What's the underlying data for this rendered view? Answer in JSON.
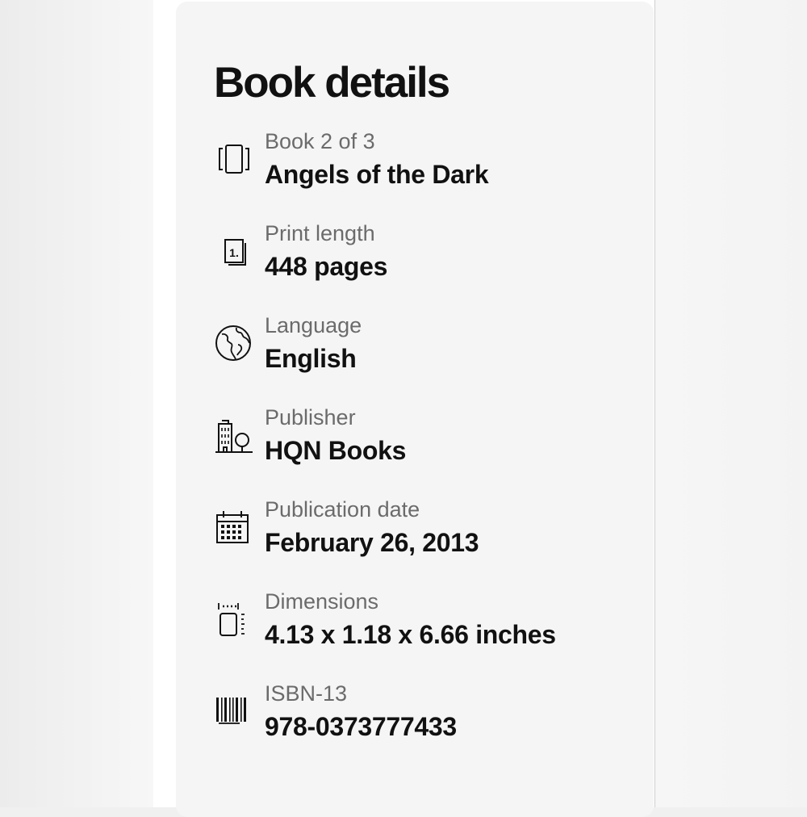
{
  "card": {
    "title": "Book details"
  },
  "details": [
    {
      "icon": "book-series-icon",
      "label": "Book 2 of 3",
      "value": "Angels of the Dark"
    },
    {
      "icon": "print-length-icon",
      "label": "Print length",
      "value": "448 pages"
    },
    {
      "icon": "globe-icon",
      "label": "Language",
      "value": "English"
    },
    {
      "icon": "building-tree-icon",
      "label": "Publisher",
      "value": "HQN Books"
    },
    {
      "icon": "calendar-icon",
      "label": "Publication date",
      "value": "February 26, 2013"
    },
    {
      "icon": "dimensions-icon",
      "label": "Dimensions",
      "value": "4.13 x 1.18 x 6.66 inches"
    },
    {
      "icon": "barcode-icon",
      "label": "ISBN-13",
      "value": "978-0373777433"
    }
  ]
}
